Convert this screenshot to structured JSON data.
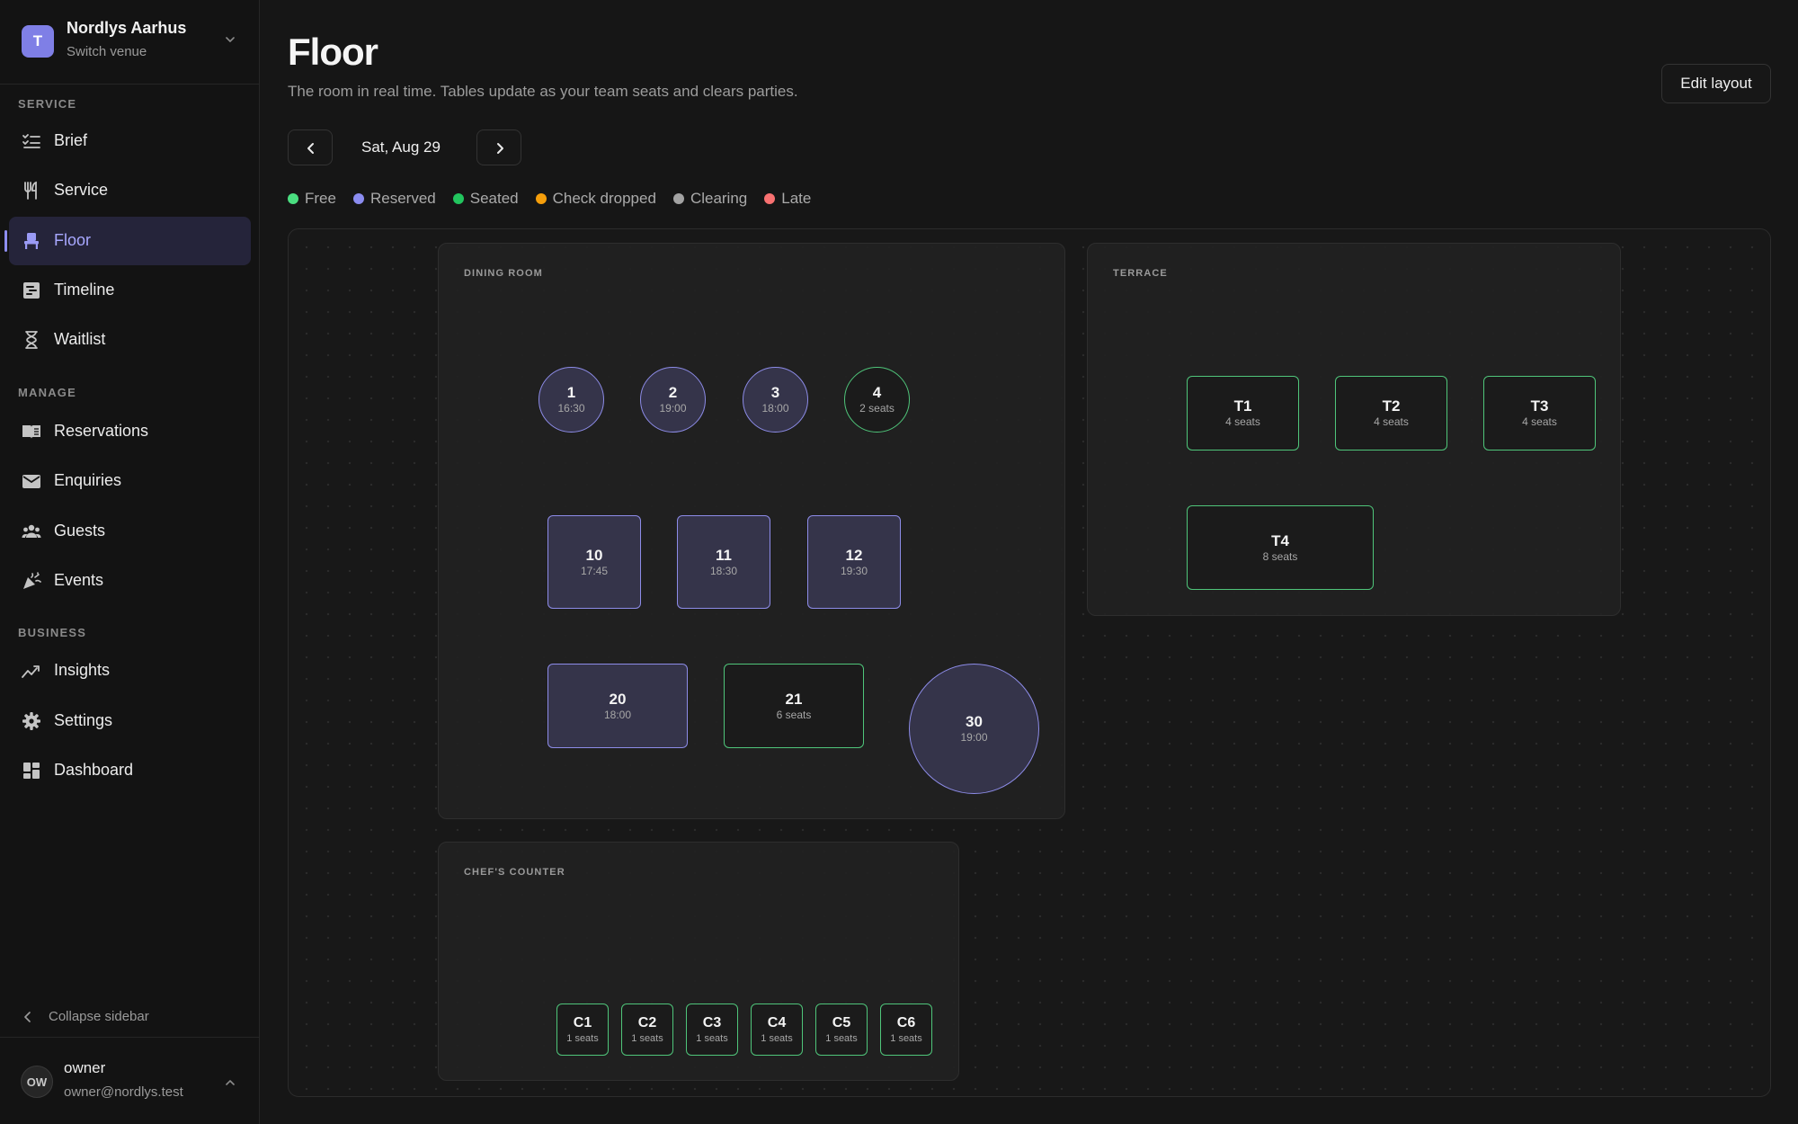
{
  "venue": {
    "logo_letter": "T",
    "name": "Nordlys Aarhus",
    "sub": "Switch venue"
  },
  "nav": {
    "sections": [
      {
        "label": "SERVICE",
        "items": [
          {
            "label": "Brief",
            "icon": "checklist-icon"
          },
          {
            "label": "Service",
            "icon": "utensils-icon"
          },
          {
            "label": "Floor",
            "icon": "chair-icon",
            "active": true
          },
          {
            "label": "Timeline",
            "icon": "timeline-icon"
          },
          {
            "label": "Waitlist",
            "icon": "hourglass-icon"
          }
        ]
      },
      {
        "label": "MANAGE",
        "items": [
          {
            "label": "Reservations",
            "icon": "book-icon"
          },
          {
            "label": "Enquiries",
            "icon": "mail-icon"
          },
          {
            "label": "Guests",
            "icon": "users-icon"
          },
          {
            "label": "Events",
            "icon": "party-icon"
          }
        ]
      },
      {
        "label": "BUSINESS",
        "items": [
          {
            "label": "Insights",
            "icon": "trend-icon"
          },
          {
            "label": "Settings",
            "icon": "gear-icon"
          },
          {
            "label": "Dashboard",
            "icon": "grid-icon"
          }
        ]
      }
    ],
    "collapse_label": "Collapse sidebar"
  },
  "user": {
    "initials": "OW",
    "name": "owner",
    "email": "owner@nordlys.test"
  },
  "header": {
    "title": "Floor",
    "subtitle": "The room in real time. Tables update as your team seats and clears parties.",
    "edit_label": "Edit layout",
    "date": "Sat, Aug 29"
  },
  "legend": [
    {
      "label": "Free",
      "color": "#4ade80"
    },
    {
      "label": "Reserved",
      "color": "#8b8cf0"
    },
    {
      "label": "Seated",
      "color": "#22c55e"
    },
    {
      "label": "Check dropped",
      "color": "#f59e0b"
    },
    {
      "label": "Clearing",
      "color": "#a3a3a3"
    },
    {
      "label": "Late",
      "color": "#f87171"
    }
  ],
  "zones": [
    {
      "label": "DINING ROOM",
      "tables": [
        {
          "name": "1",
          "sub": "16:30",
          "status": "reserved",
          "shape": "round"
        },
        {
          "name": "2",
          "sub": "19:00",
          "status": "reserved",
          "shape": "round"
        },
        {
          "name": "3",
          "sub": "18:00",
          "status": "reserved",
          "shape": "round"
        },
        {
          "name": "4",
          "sub": "2 seats",
          "status": "free",
          "shape": "round"
        },
        {
          "name": "10",
          "sub": "17:45",
          "status": "reserved",
          "shape": "rect"
        },
        {
          "name": "11",
          "sub": "18:30",
          "status": "reserved",
          "shape": "rect"
        },
        {
          "name": "12",
          "sub": "19:30",
          "status": "reserved",
          "shape": "rect"
        },
        {
          "name": "20",
          "sub": "18:00",
          "status": "reserved",
          "shape": "rect"
        },
        {
          "name": "21",
          "sub": "6 seats",
          "status": "free",
          "shape": "rect"
        },
        {
          "name": "30",
          "sub": "19:00",
          "status": "reserved",
          "shape": "round"
        }
      ]
    },
    {
      "label": "TERRACE",
      "tables": [
        {
          "name": "T1",
          "sub": "4 seats",
          "status": "free",
          "shape": "rect"
        },
        {
          "name": "T2",
          "sub": "4 seats",
          "status": "free",
          "shape": "rect"
        },
        {
          "name": "T3",
          "sub": "4 seats",
          "status": "free",
          "shape": "rect"
        },
        {
          "name": "T4",
          "sub": "8 seats",
          "status": "free",
          "shape": "rect"
        }
      ]
    },
    {
      "label": "CHEF'S COUNTER",
      "tables": [
        {
          "name": "C1",
          "sub": "1 seats",
          "status": "free",
          "shape": "rect"
        },
        {
          "name": "C2",
          "sub": "1 seats",
          "status": "free",
          "shape": "rect"
        },
        {
          "name": "C3",
          "sub": "1 seats",
          "status": "free",
          "shape": "rect"
        },
        {
          "name": "C4",
          "sub": "1 seats",
          "status": "free",
          "shape": "rect"
        },
        {
          "name": "C5",
          "sub": "1 seats",
          "status": "free",
          "shape": "rect"
        },
        {
          "name": "C6",
          "sub": "1 seats",
          "status": "free",
          "shape": "rect"
        }
      ]
    }
  ]
}
